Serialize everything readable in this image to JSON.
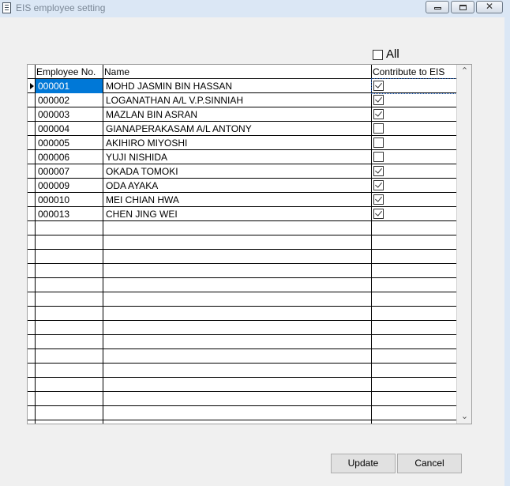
{
  "window": {
    "title": "EIS employee setting",
    "close_glyph": "✕"
  },
  "select_all": {
    "label": "All",
    "checked": false
  },
  "grid": {
    "headers": {
      "employee_no": "Employee No.",
      "name": "Name",
      "contribute": "Contribute to EIS"
    },
    "rows": [
      {
        "employee_no": "000001",
        "name": "MOHD JASMIN BIN HASSAN",
        "contribute": true
      },
      {
        "employee_no": "000002",
        "name": "LOGANATHAN A/L V.P.SINNIAH",
        "contribute": true
      },
      {
        "employee_no": "000003",
        "name": "MAZLAN BIN ASRAN",
        "contribute": true
      },
      {
        "employee_no": "000004",
        "name": "GIANAPERAKASAM A/L ANTONY",
        "contribute": false
      },
      {
        "employee_no": "000005",
        "name": "AKIHIRO MIYOSHI",
        "contribute": false
      },
      {
        "employee_no": "000006",
        "name": "YUJI NISHIDA",
        "contribute": false
      },
      {
        "employee_no": "000007",
        "name": "OKADA TOMOKI",
        "contribute": true
      },
      {
        "employee_no": "000009",
        "name": "ODA AYAKA",
        "contribute": true
      },
      {
        "employee_no": "000010",
        "name": "MEI CHIAN HWA",
        "contribute": true
      },
      {
        "employee_no": "000013",
        "name": "CHEN JING WEI",
        "contribute": true
      }
    ],
    "scroll_up_glyph": "⌃",
    "scroll_down_glyph": "⌄"
  },
  "buttons": {
    "update": "Update",
    "cancel": "Cancel"
  },
  "colors": {
    "selection": "#0078d7",
    "titlebar": "#dbe7f5"
  }
}
